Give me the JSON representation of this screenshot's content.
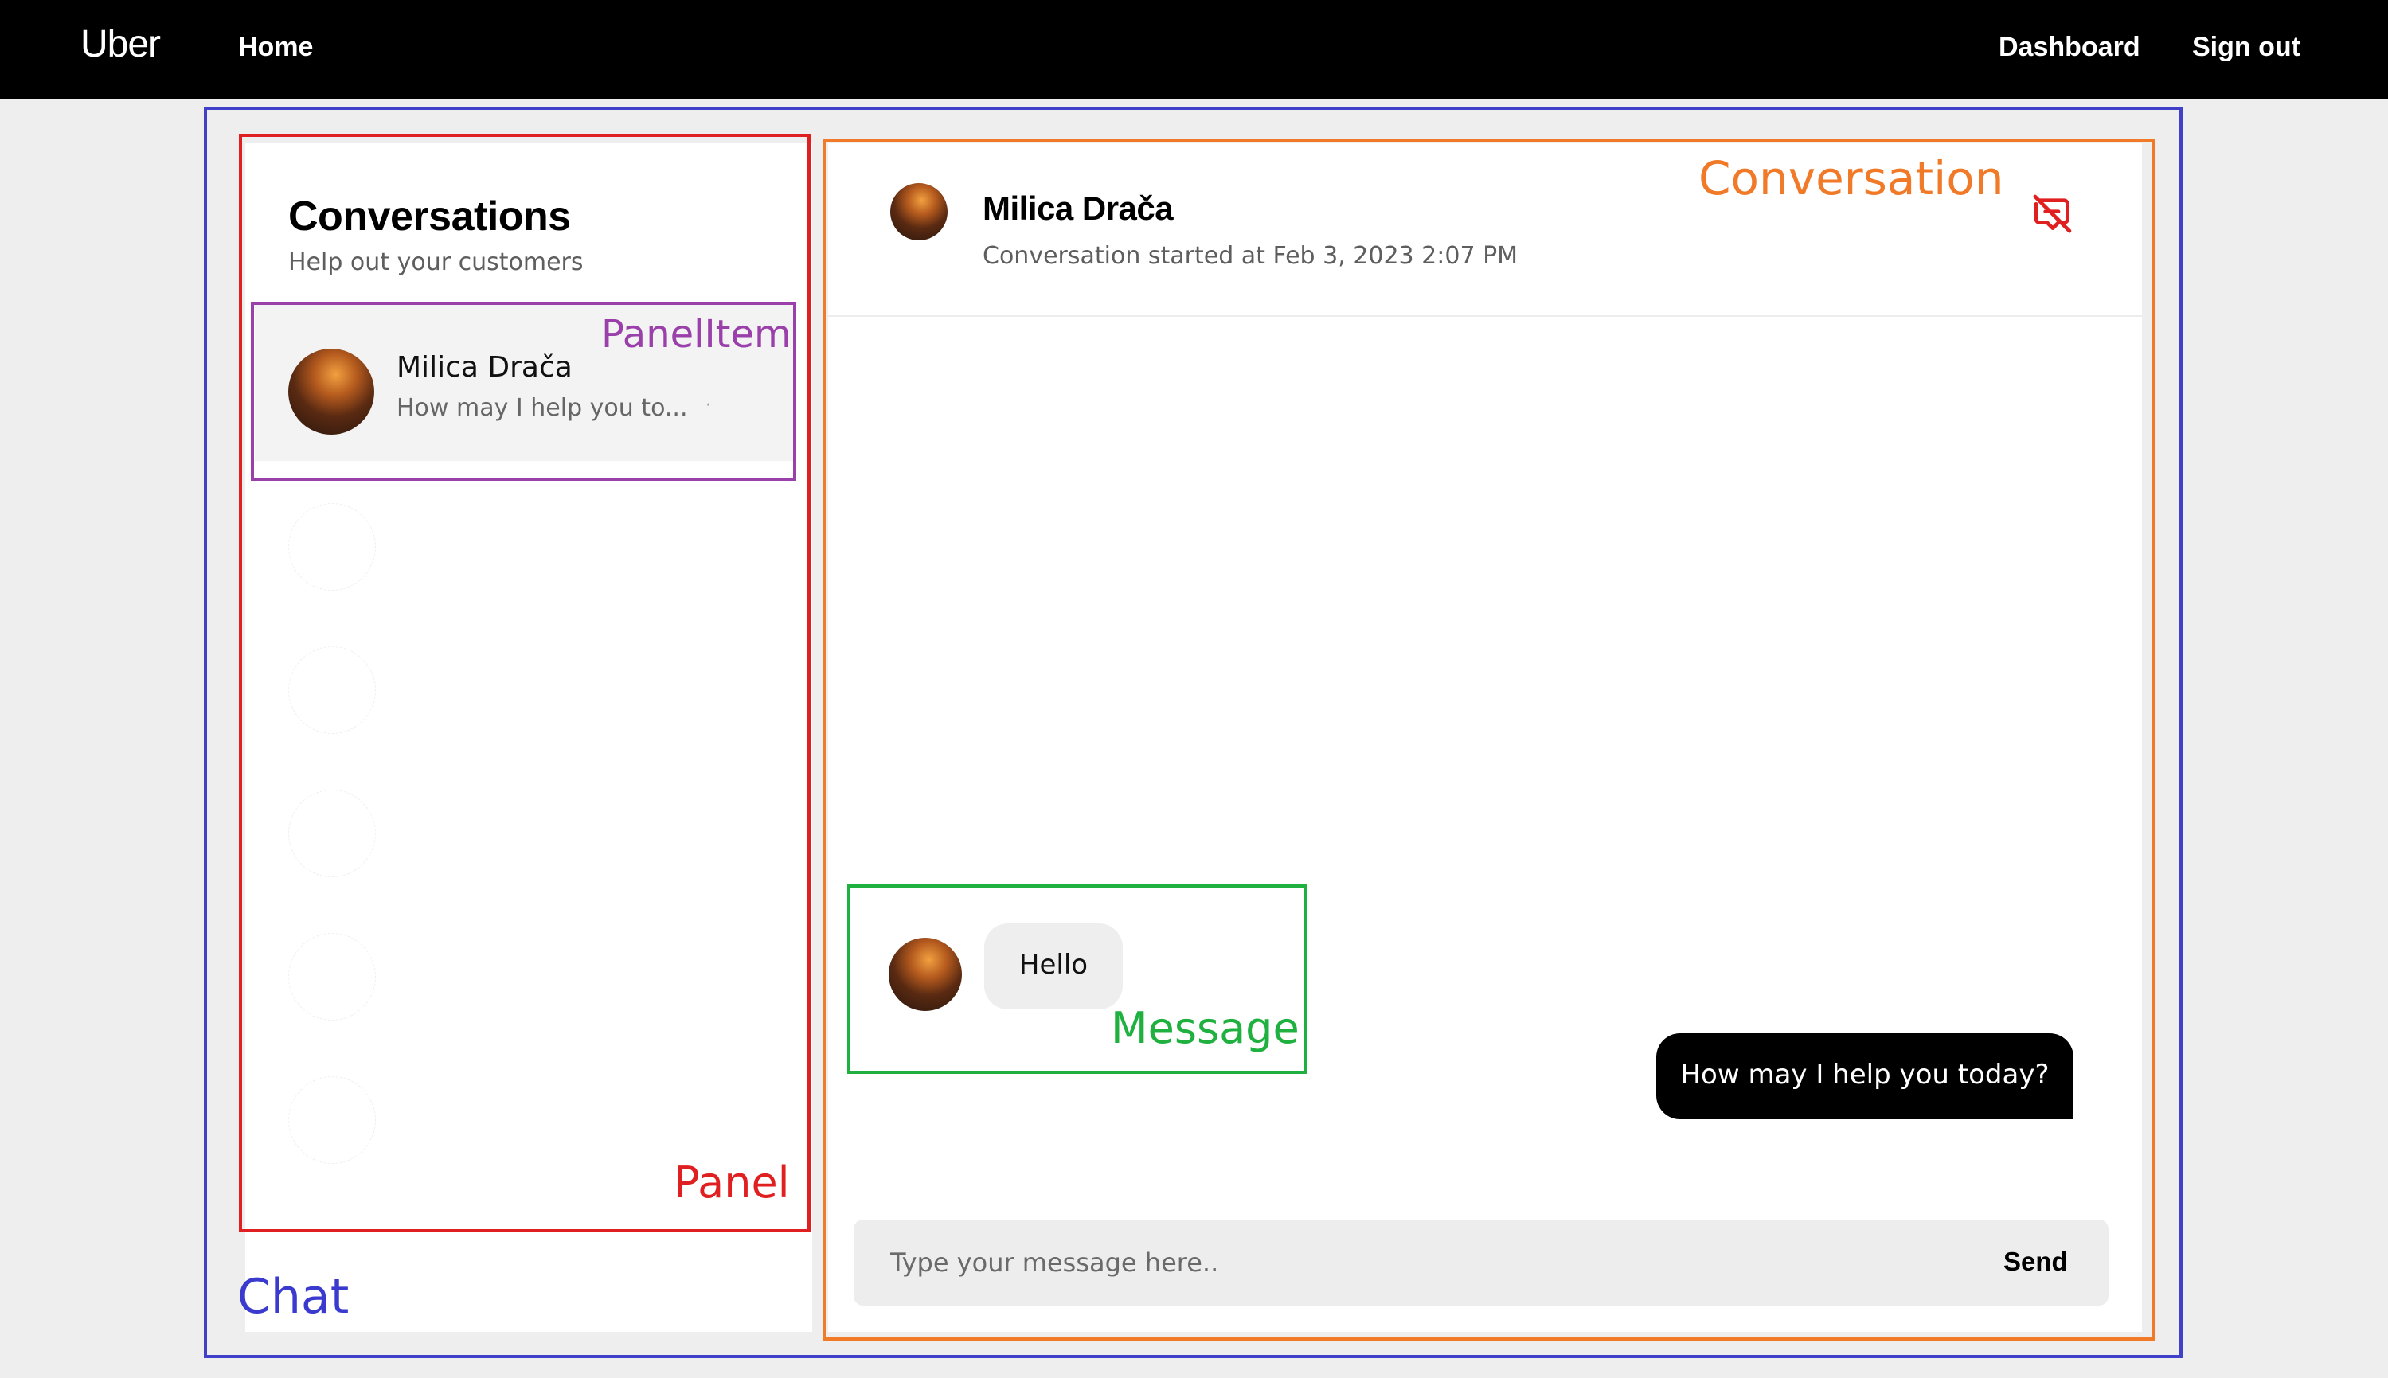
{
  "topbar": {
    "brand": "Uber",
    "home": "Home",
    "dashboard": "Dashboard",
    "sign_out": "Sign out"
  },
  "annotations": {
    "chat": "Chat",
    "panel": "Panel",
    "panel_item": "PanelItem",
    "conversation": "Conversation",
    "message": "Message"
  },
  "panel": {
    "title": "Conversations",
    "subtitle": "Help out your customers",
    "items": [
      {
        "name": "Milica Drača",
        "preview": "How may I help you to...",
        "dot": "·"
      }
    ]
  },
  "conversation": {
    "name": "Milica Drača",
    "started": "Conversation started at Feb 3, 2023 2:07 PM",
    "close_icon": "chat-off-icon",
    "messages": [
      {
        "direction": "incoming",
        "text": "Hello"
      },
      {
        "direction": "outgoing",
        "text": "How may I help you today?"
      }
    ],
    "composer": {
      "placeholder": "Type your message here..",
      "value": "",
      "send_label": "Send"
    }
  },
  "colors": {
    "chat_annotation": "#4040c8",
    "panel_annotation": "#e02020",
    "panel_item_annotation": "#9a40aa",
    "conversation_annotation": "#f07a28",
    "message_annotation": "#20b040",
    "outgoing_bubble": "#000000",
    "incoming_bubble": "#eeeeee"
  }
}
